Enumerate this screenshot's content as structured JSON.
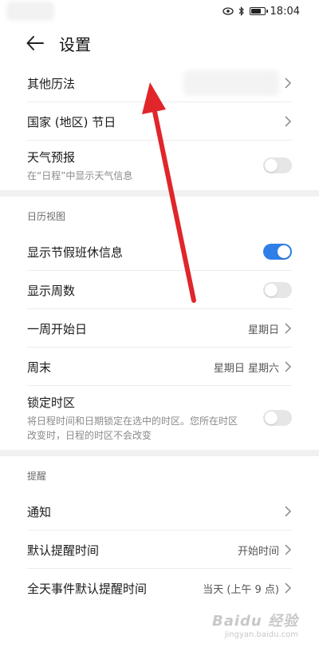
{
  "status": {
    "time": "18:04"
  },
  "header": {
    "title": "设置"
  },
  "rows": [
    {
      "label": "其他历法"
    },
    {
      "label": "国家 (地区) 节日"
    },
    {
      "label": "天气预报",
      "sub": "在“日程”中显示天气信息",
      "toggle": false
    }
  ],
  "sections": [
    {
      "title": "日历视图",
      "rows": [
        {
          "label": "显示节假班休信息",
          "toggle": true
        },
        {
          "label": "显示周数",
          "toggle": false
        },
        {
          "label": "一周开始日",
          "value": "星期日"
        },
        {
          "label": "周末",
          "value": "星期日 星期六"
        },
        {
          "label": "锁定时区",
          "sub": "将日程时间和日期锁定在选中的时区。您所在时区改变时，日程的时区不会改变",
          "toggle": false
        }
      ]
    },
    {
      "title": "提醒",
      "rows": [
        {
          "label": "通知"
        },
        {
          "label": "默认提醒时间",
          "value": "开始时间"
        },
        {
          "label": "全天事件默认提醒时间",
          "value": "当天 (上午 9 点)"
        }
      ]
    }
  ],
  "watermark": {
    "main": "Baidu 经验",
    "sub": "jingyan.baidu.com"
  },
  "colors": {
    "accent": "#2f7fe8",
    "arrow": "#e0262b"
  }
}
